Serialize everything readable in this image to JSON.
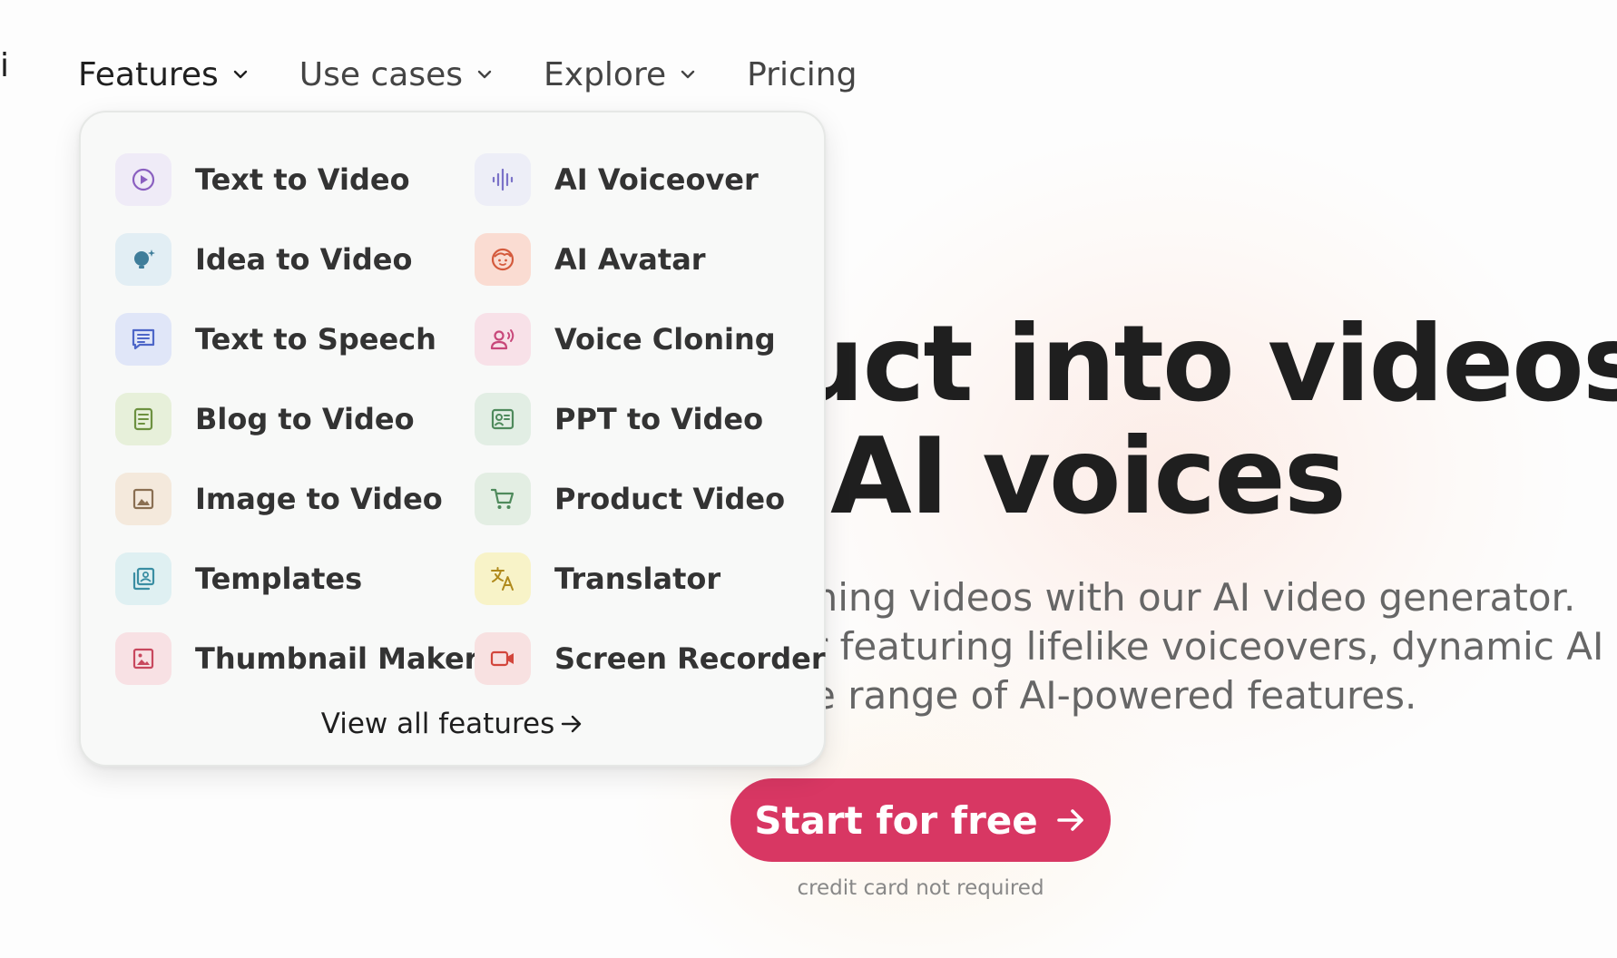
{
  "nav": {
    "items": [
      {
        "label": "Features",
        "has_chevron": true,
        "active": true
      },
      {
        "label": "Use cases",
        "has_chevron": true,
        "active": false
      },
      {
        "label": "Explore",
        "has_chevron": true,
        "active": false
      },
      {
        "label": "Pricing",
        "has_chevron": false,
        "active": false
      }
    ]
  },
  "features_menu": {
    "items": [
      {
        "label": "Text to Video",
        "icon": "play-circle-icon",
        "bg": "#efebf7",
        "color": "#8a5fc0"
      },
      {
        "label": "AI Voiceover",
        "icon": "sound-wave-icon",
        "bg": "#edeef7",
        "color": "#7b72c8"
      },
      {
        "label": "Idea to Video",
        "icon": "lightbulb-icon",
        "bg": "#e2eef4",
        "color": "#3f7d9a"
      },
      {
        "label": "AI Avatar",
        "icon": "face-icon",
        "bg": "#fadcd2",
        "color": "#d45a3c"
      },
      {
        "label": "Text to Speech",
        "icon": "message-icon",
        "bg": "#e0e6f8",
        "color": "#4d66c8"
      },
      {
        "label": "Voice Cloning",
        "icon": "user-voice-icon",
        "bg": "#f8e1e8",
        "color": "#c8487a"
      },
      {
        "label": "Blog to Video",
        "icon": "document-icon",
        "bg": "#e7f0da",
        "color": "#6d9140"
      },
      {
        "label": "PPT to Video",
        "icon": "presentation-icon",
        "bg": "#e2eee4",
        "color": "#4f8a5c"
      },
      {
        "label": "Image to Video",
        "icon": "image-icon",
        "bg": "#f4e9dc",
        "color": "#8a6f52"
      },
      {
        "label": "Product Video",
        "icon": "cart-icon",
        "bg": "#e3eee3",
        "color": "#4f8a5c"
      },
      {
        "label": "Templates",
        "icon": "templates-icon",
        "bg": "#dff0f2",
        "color": "#3a8ea3"
      },
      {
        "label": "Translator",
        "icon": "translate-icon",
        "bg": "#f8f3c8",
        "color": "#b08a1c"
      },
      {
        "label": "Thumbnail Maker",
        "icon": "picture-icon",
        "bg": "#f8e1e4",
        "color": "#c8485e"
      },
      {
        "label": "Screen Recorder",
        "icon": "video-camera-icon",
        "bg": "#f8e1e1",
        "color": "#d2463c"
      }
    ],
    "footer_label": "View all features"
  },
  "hero": {
    "title_line1": "uct into videos",
    "title_line2": "AI voices",
    "sub_line1": "nning videos with our AI video generator.",
    "sub_line2": "r featuring lifelike voiceovers, dynamic AI",
    "sub_line3": "e range of AI-powered features.",
    "cta_label": "Start for free",
    "cta_note": "credit card not required"
  },
  "colors": {
    "cta_bg": "#d83763",
    "text_dark": "#1f1f1f"
  }
}
